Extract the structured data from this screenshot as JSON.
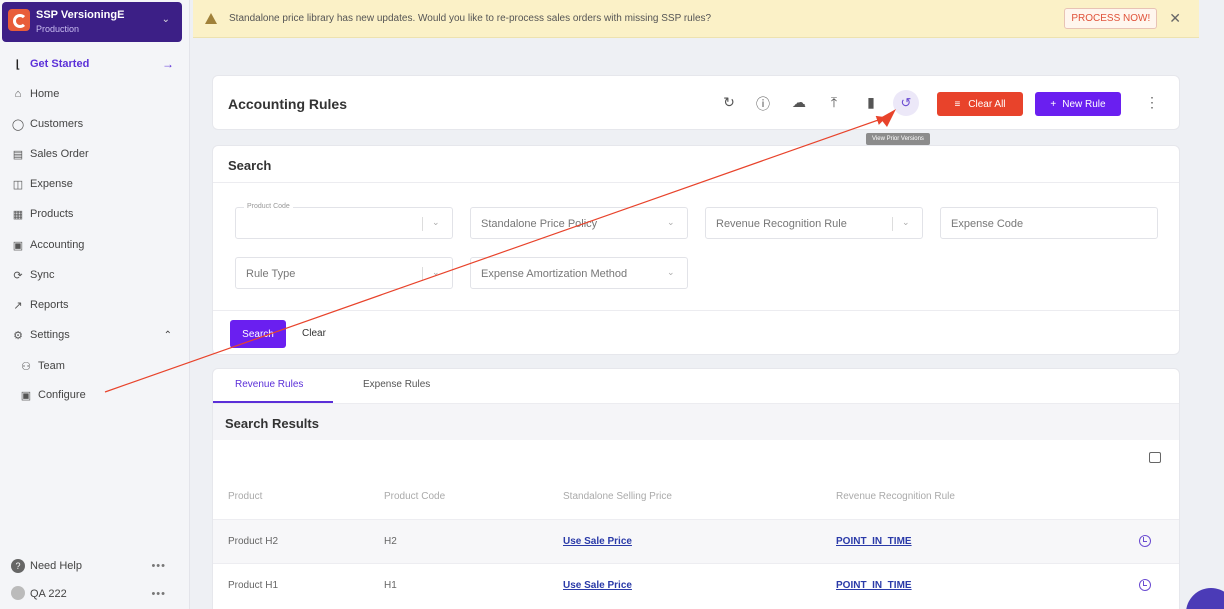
{
  "org": {
    "name": "SSP VersioningE",
    "env": "Production"
  },
  "sidebar": {
    "get_started": "Get Started",
    "items": [
      {
        "label": "Home",
        "icon": "home-icon"
      },
      {
        "label": "Customers",
        "icon": "customers-icon"
      },
      {
        "label": "Sales Order",
        "icon": "sales-order-icon"
      },
      {
        "label": "Expense",
        "icon": "expense-icon"
      },
      {
        "label": "Products",
        "icon": "products-icon"
      },
      {
        "label": "Accounting",
        "icon": "accounting-icon"
      },
      {
        "label": "Sync",
        "icon": "sync-icon"
      },
      {
        "label": "Reports",
        "icon": "reports-icon"
      },
      {
        "label": "Settings",
        "icon": "gear-icon"
      }
    ],
    "sub_items": [
      {
        "label": "Team",
        "icon": "team-icon"
      },
      {
        "label": "Configure",
        "icon": "configure-icon"
      }
    ],
    "footer": {
      "help": "Need Help",
      "user": "QA 222"
    }
  },
  "banner": {
    "message": "Standalone price library has new updates. Would you like to re-process sales orders with missing SSP rules?",
    "action": "PROCESS NOW!"
  },
  "header": {
    "title": "Accounting Rules",
    "clear_all": "Clear All",
    "new_rule": "New Rule",
    "tooltip": "View Prior Versions"
  },
  "search": {
    "title": "Search",
    "fields": {
      "product_code_label": "Product Code",
      "ssp_policy": "Standalone Price Policy",
      "rev_rule": "Revenue Recognition Rule",
      "expense_code": "Expense Code",
      "rule_type": "Rule Type",
      "amort_method": "Expense Amortization Method"
    },
    "search_btn": "Search",
    "clear_btn": "Clear"
  },
  "results": {
    "tabs": [
      "Revenue Rules",
      "Expense Rules"
    ],
    "title": "Search Results",
    "columns": [
      "Product",
      "Product Code",
      "Standalone Selling Price",
      "Revenue Recognition Rule"
    ],
    "rows": [
      {
        "product": "Product H2",
        "code": "H2",
        "ssp": "Use Sale Price",
        "rule": "POINT_IN_TIME"
      },
      {
        "product": "Product H1",
        "code": "H1",
        "ssp": "Use Sale Price",
        "rule": "POINT_IN_TIME"
      }
    ]
  },
  "colors": {
    "primary": "#6a1ff0",
    "danger": "#e8432b",
    "banner": "#fbf1c7",
    "org": "#3c1f86"
  }
}
